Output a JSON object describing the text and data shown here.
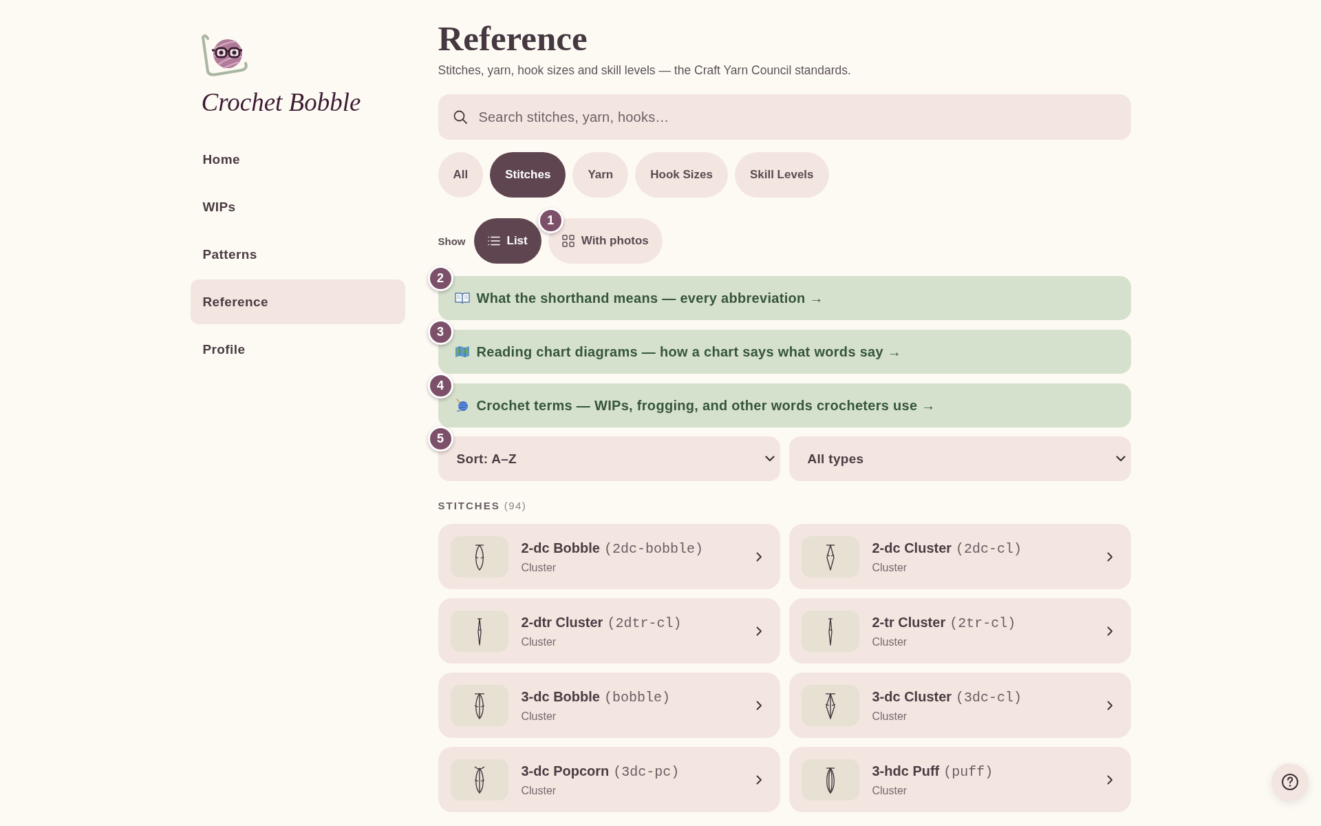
{
  "sidebar": {
    "logo_text": "Crochet Bobble",
    "nav": [
      {
        "label": "Home",
        "selected": false
      },
      {
        "label": "WIPs",
        "selected": false
      },
      {
        "label": "Patterns",
        "selected": false
      },
      {
        "label": "Reference",
        "selected": true
      },
      {
        "label": "Profile",
        "selected": false
      }
    ]
  },
  "page": {
    "title": "Reference",
    "subtitle": "Stitches, yarn, hook sizes and skill levels — the Craft Yarn Council standards."
  },
  "search": {
    "placeholder": "Search stitches, yarn, hooks…"
  },
  "tabs": [
    {
      "label": "All",
      "selected": false
    },
    {
      "label": "Stitches",
      "selected": true
    },
    {
      "label": "Yarn",
      "selected": false
    },
    {
      "label": "Hook Sizes",
      "selected": false
    },
    {
      "label": "Skill Levels",
      "selected": false
    }
  ],
  "view": {
    "label": "Show",
    "options": [
      {
        "label": "List",
        "kind": "list",
        "selected": true
      },
      {
        "label": "With photos",
        "kind": "grid",
        "selected": false,
        "step": "1"
      }
    ]
  },
  "guides": [
    {
      "text": "What the shorthand means — every abbreviation →",
      "kind": "book",
      "step": "2"
    },
    {
      "text": "Reading chart diagrams — how a chart says what words say →",
      "kind": "map",
      "step": "3"
    },
    {
      "text": "Crochet terms — WIPs, frogging, and other words crocheters use →",
      "kind": "yarn",
      "step": "4"
    }
  ],
  "sort": {
    "value": "Sort: A–Z",
    "step": "5"
  },
  "type_filter": {
    "value": "All types"
  },
  "section": {
    "label": "STITCHES",
    "count": "(94)"
  },
  "stitches": [
    {
      "name": "2-dc Bobble",
      "abbreviation": "(2dc-bobble)",
      "category": "Cluster",
      "kind": "oval"
    },
    {
      "name": "2-dc Cluster",
      "abbreviation": "(2dc-cl)",
      "category": "Cluster",
      "kind": "diamond"
    },
    {
      "name": "2-dtr Cluster",
      "abbreviation": "(2dtr-cl)",
      "category": "Cluster",
      "kind": "spindle"
    },
    {
      "name": "2-tr Cluster",
      "abbreviation": "(2tr-cl)",
      "category": "Cluster",
      "kind": "spindle"
    },
    {
      "name": "3-dc Bobble",
      "abbreviation": "(bobble)",
      "category": "Cluster",
      "kind": "triple-oval"
    },
    {
      "name": "3-dc Cluster",
      "abbreviation": "(3dc-cl)",
      "category": "Cluster",
      "kind": "triple-diamond"
    },
    {
      "name": "3-dc Popcorn",
      "abbreviation": "(3dc-pc)",
      "category": "Cluster",
      "kind": "popcorn"
    },
    {
      "name": "3-hdc Puff",
      "abbreviation": "(puff)",
      "category": "Cluster",
      "kind": "puff"
    }
  ]
}
